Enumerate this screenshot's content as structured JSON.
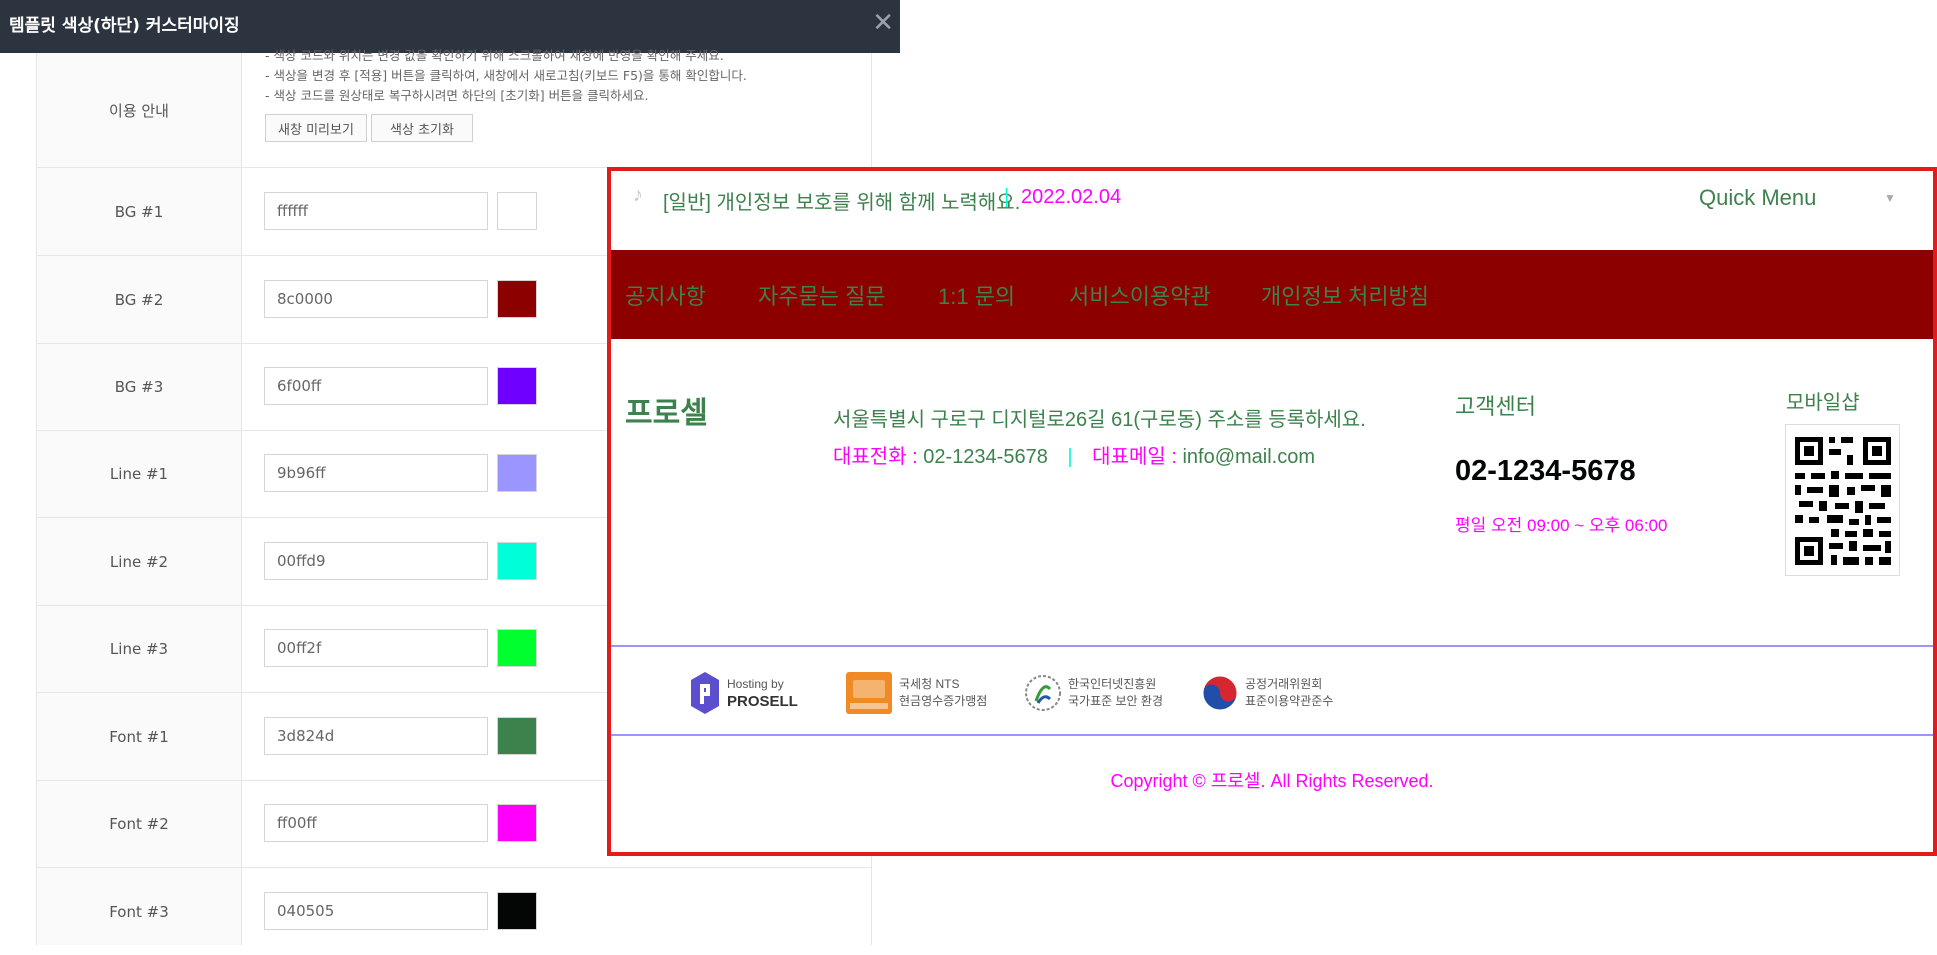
{
  "modal": {
    "title": "템플릿 색상(하단) 커스터마이징",
    "close_glyph": "✕"
  },
  "guide": {
    "label": "이용 안내",
    "lines": [
      "- 색상 코드와 위치는 변경 값을 확인하기 위해 스크롤하여 새창에 반영을 확인해 주세요.",
      "- 색상을 변경 후 [적용] 버튼을 클릭하여, 새창에서 새로고침(키보드 F5)을 통해 확인합니다.",
      "- 색상 코드를 원상태로 복구하시려면 하단의 [초기화] 버튼을 클릭하세요."
    ],
    "preview_button": "새창 미리보기",
    "reset_button": "색상 초기화"
  },
  "color_rows": [
    {
      "label": "BG #1",
      "value": "ffffff",
      "swatch": "#ffffff"
    },
    {
      "label": "BG #2",
      "value": "8c0000",
      "swatch": "#8c0000"
    },
    {
      "label": "BG #3",
      "value": "6f00ff",
      "swatch": "#6f00ff"
    },
    {
      "label": "Line #1",
      "value": "9b96ff",
      "swatch": "#9b96ff"
    },
    {
      "label": "Line #2",
      "value": "00ffd9",
      "swatch": "#00ffd9"
    },
    {
      "label": "Line #3",
      "value": "00ff2f",
      "swatch": "#00ff2f"
    },
    {
      "label": "Font #1",
      "value": "3d824d",
      "swatch": "#3d824d"
    },
    {
      "label": "Font #2",
      "value": "ff00ff",
      "swatch": "#ff00ff"
    },
    {
      "label": "Font #3",
      "value": "040505",
      "swatch": "#040505"
    }
  ],
  "preview": {
    "notice_text": "[일반] 개인정보 보호를 위해 함께 노력해요.",
    "notice_sep": "|",
    "notice_date": "2022.02.04",
    "quick_menu": "Quick Menu",
    "quick_menu_arrow": "▼",
    "nav": [
      "공지사항",
      "자주묻는 질문",
      "1:1 문의",
      "서비스이용약관",
      "개인정보 처리방침"
    ],
    "logo": "프로셀",
    "address": "서울특별시 구로구 디지털로26길 61(구로동) 주소를 등록하세요.",
    "phone_label": "대표전화 :",
    "phone": "02-1234-5678",
    "contact_sep": "|",
    "email_label": "대표메일 :",
    "email": "info@mail.com",
    "cs_title": "고객센터",
    "cs_phone": "02-1234-5678",
    "cs_hours": "평일 오전 09:00 ~ 오후 06:00",
    "mobile_title": "모바일샵",
    "badges": [
      {
        "line1": "Hosting by",
        "line2": "PROSELL"
      },
      {
        "line1": "국세청 NTS",
        "line2": "현금영수증가맹점"
      },
      {
        "line1": "한국인터넷진흥원",
        "line2": "국가표준 보안 환경"
      },
      {
        "line1": "공정거래위원회",
        "line2": "표준이용약관준수"
      }
    ],
    "copyright": "Copyright © 프로셀. All Rights Reserved."
  },
  "colors": {
    "font1": "#3d824d",
    "font2": "#ff00ff",
    "font3": "#040505",
    "bg2": "#8c0000",
    "line1": "#9b96ff",
    "line2": "#00ffd9",
    "border": "#e21b1b"
  }
}
